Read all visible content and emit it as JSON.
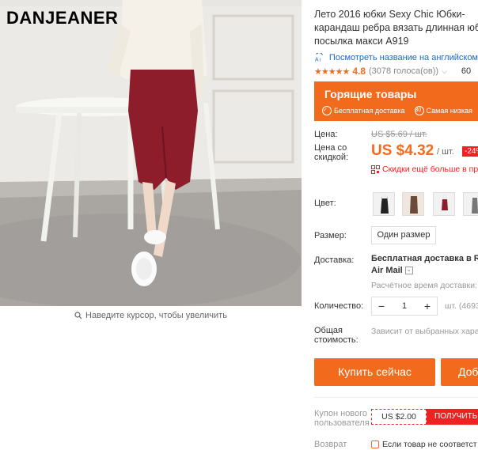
{
  "gallery": {
    "brand": "DANJEANER",
    "zoom_hint": "Наведите курсор, чтобы увеличить"
  },
  "product": {
    "title": "Лето 2016 юбки Sexy Chic Юбки-карандаш ребра вязать длинная юбка посылка макси A919",
    "translate_link": "Посмотреть название на английском",
    "rating": {
      "stars": "★★★★★",
      "score": "4.8",
      "votes": "(3078 голоса(ов))",
      "orders": "60"
    },
    "hot_deals": {
      "title": "Горящие товары",
      "badge1": "Бесплатная доставка",
      "badge2": "Самая низкая"
    }
  },
  "price": {
    "label": "Цена:",
    "discount_label": "Цена со скидкой:",
    "old": "US $5.69 / шт.",
    "new": "US $4.32",
    "unit": "/ шт.",
    "discount": "-24%",
    "promo": "Скидки ещё больше в пр"
  },
  "options": {
    "color_label": "Цвет:",
    "size_label": "Размер:",
    "size_value": "Один размер"
  },
  "shipping": {
    "label": "Доставка:",
    "free": "Бесплатная доставка в Ru",
    "method": "Air Mail",
    "time": "Расчётное время доставки:"
  },
  "quantity": {
    "label": "Количество:",
    "minus": "−",
    "value": "1",
    "plus": "+",
    "available": "шт. (4693"
  },
  "total": {
    "label": "Общая стоимость:",
    "value": "Зависит от выбранных хара"
  },
  "actions": {
    "buy": "Купить сейчас",
    "add": "Доб"
  },
  "coupon": {
    "label": "Купон нового пользователя",
    "amount": "US $2.00",
    "get": "ПОЛУЧИТЬ"
  },
  "returns": {
    "label": "Возврат",
    "text": "Если товар не соответст"
  },
  "colors": {
    "accent": "#f26b1d",
    "red": "#e22222",
    "link": "#1a6bc0",
    "skirt": "#8e1d2c"
  }
}
